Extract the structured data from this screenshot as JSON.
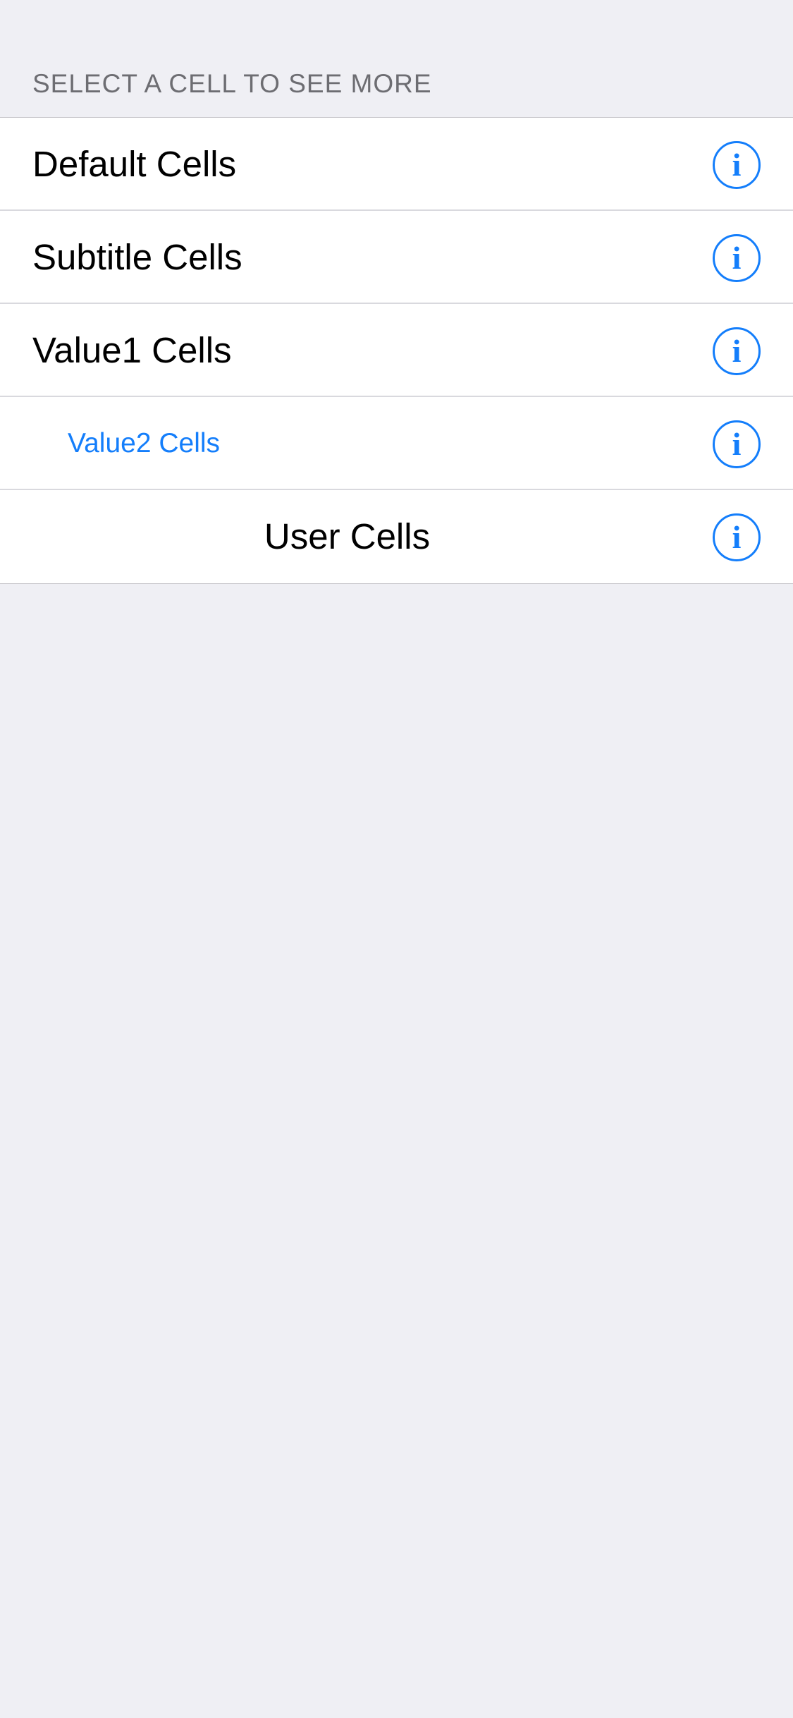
{
  "table": {
    "section_header": "SELECT A CELL TO SEE MORE",
    "cells": [
      {
        "label": "Default Cells",
        "info_icon": "info-circle-icon"
      },
      {
        "label": "Subtitle Cells",
        "info_icon": "info-circle-icon"
      },
      {
        "label": "Value1 Cells",
        "info_icon": "info-circle-icon"
      },
      {
        "label": "Value2 Cells",
        "info_icon": "info-circle-icon"
      },
      {
        "label": "User Cells",
        "info_icon": "info-circle-icon"
      }
    ],
    "info_glyph": "i"
  },
  "colors": {
    "accent": "#147efb",
    "background": "#efeff4",
    "header_text": "#6d6d72",
    "separator": "#d9d9de"
  }
}
